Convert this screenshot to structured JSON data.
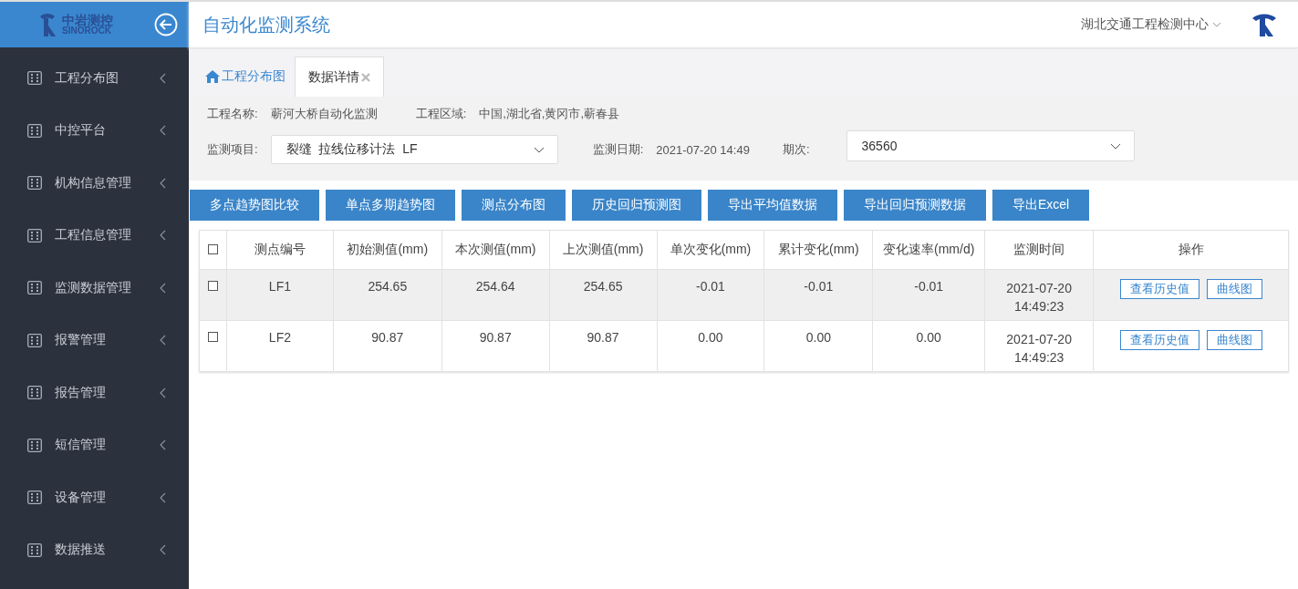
{
  "sidebar": {
    "logo_cn": "中岩测控",
    "logo_en": "SINOROCK",
    "items": [
      {
        "label": "工程分布图"
      },
      {
        "label": "中控平台"
      },
      {
        "label": "机构信息管理"
      },
      {
        "label": "工程信息管理"
      },
      {
        "label": "监测数据管理"
      },
      {
        "label": "报警管理"
      },
      {
        "label": "报告管理"
      },
      {
        "label": "短信管理"
      },
      {
        "label": "设备管理"
      },
      {
        "label": "数据推送"
      }
    ]
  },
  "header": {
    "title": "自动化监测系统",
    "org": "湖北交通工程检测中心"
  },
  "tabs": [
    {
      "label": "工程分布图",
      "kind": "home",
      "selected": false
    },
    {
      "label": "数据详情",
      "kind": "closable",
      "selected": true
    }
  ],
  "info": {
    "project_name_label": "工程名称:",
    "project_name": "蕲河大桥自动化监测",
    "region_label": "工程区域:",
    "region": "中国,湖北省,黄冈市,蕲春县",
    "item_label": "监测项目:",
    "item_value": "裂缝  拉线位移计法  LF",
    "date_label": "监测日期:",
    "date": "2021-07-20 14:49",
    "period_label": "期次:",
    "period_value": "36560"
  },
  "buttons": [
    "多点趋势图比较",
    "单点多期趋势图",
    "测点分布图",
    "历史回归预测图",
    "导出平均值数据",
    "导出回归预测数据",
    "导出Excel"
  ],
  "table": {
    "columns": [
      "测点编号",
      "初始测值(mm)",
      "本次测值(mm)",
      "上次测值(mm)",
      "单次变化(mm)",
      "累计变化(mm)",
      "变化速率(mm/d)",
      "监测时间",
      "操作"
    ],
    "header_checked": false,
    "rows": [
      {
        "checked": false,
        "selected": true,
        "cells": [
          "LF1",
          "254.65",
          "254.64",
          "254.65",
          "-0.01",
          "-0.01",
          "-0.01",
          "2021-07-20 14:49:23"
        ],
        "actions": [
          "查看历史值",
          "曲线图"
        ]
      },
      {
        "checked": false,
        "selected": false,
        "cells": [
          "LF2",
          "90.87",
          "90.87",
          "90.87",
          "0.00",
          "0.00",
          "0.00",
          "2021-07-20 14:49:23"
        ],
        "actions": [
          "查看历史值",
          "曲线图"
        ]
      }
    ]
  }
}
